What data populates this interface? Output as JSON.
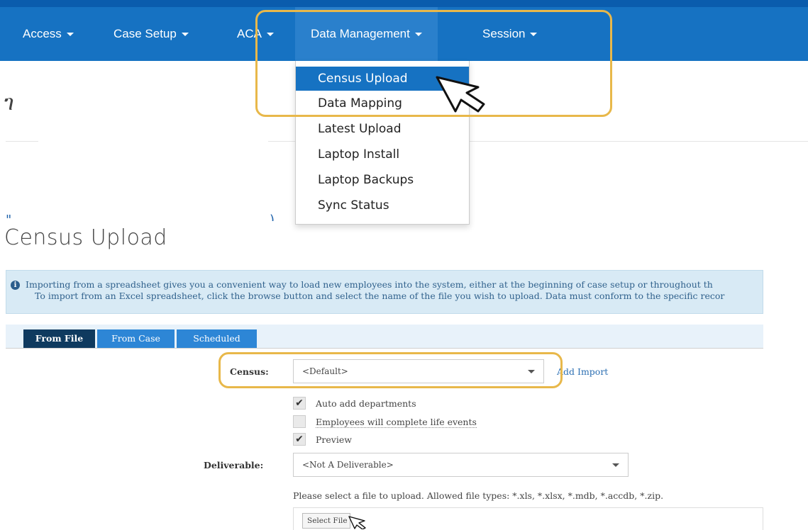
{
  "nav": {
    "items": [
      {
        "label": "Access"
      },
      {
        "label": "Case Setup"
      },
      {
        "label": "ACA"
      },
      {
        "label": "Data Management"
      },
      {
        "label": "Session"
      }
    ]
  },
  "dropdown": {
    "items": [
      {
        "label": "Census Upload"
      },
      {
        "label": "Data Mapping"
      },
      {
        "label": "Latest Upload"
      },
      {
        "label": "Laptop Install"
      },
      {
        "label": "Laptop Backups"
      },
      {
        "label": "Sync Status"
      }
    ],
    "selected": "Census Upload"
  },
  "page": {
    "partial_heading": "ገ",
    "title": "Census Upload"
  },
  "info": {
    "line1": "Importing from a spreadsheet gives you a convenient way to load new employees into the system, either at the beginning of case setup or throughout th",
    "line2": "To import from an Excel spreadsheet, click the browse button and select the name of the file you wish to upload. Data must conform to the specific recor"
  },
  "tabs": [
    {
      "label": "From File"
    },
    {
      "label": "From Case"
    },
    {
      "label": "Scheduled"
    }
  ],
  "form": {
    "census_label": "Census:",
    "census_value": "<Default>",
    "add_import": "Add Import",
    "checkboxes": [
      {
        "label": "Auto add departments",
        "checked": true
      },
      {
        "label": "Employees will complete life events",
        "checked": false
      },
      {
        "label": "Preview",
        "checked": true
      }
    ],
    "deliverable_label": "Deliverable:",
    "deliverable_value": "<Not A Deliverable>",
    "upload_note": "Please select a file to upload. Allowed file types: *.xls, *.xlsx, *.mdb, *.accdb, *.zip.",
    "select_file": "Select File"
  },
  "colors": {
    "nav_bg": "#1672c2",
    "highlight": "#e8b84a",
    "tab_active": "#0f3a5f",
    "tab_inactive": "#2d86d6"
  }
}
